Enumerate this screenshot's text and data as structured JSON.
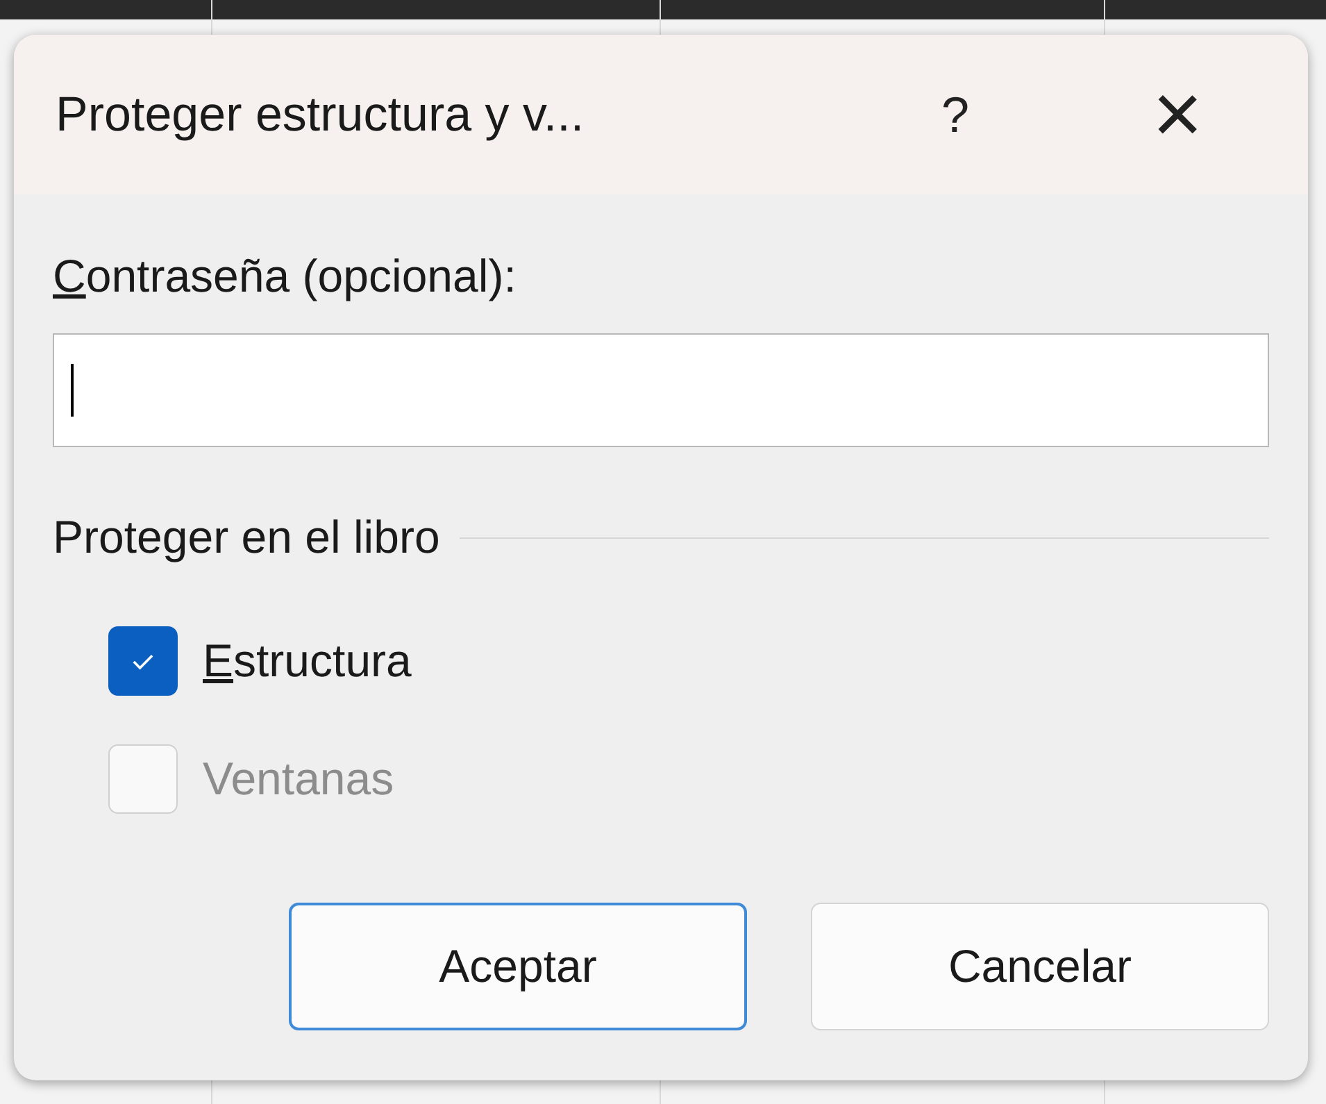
{
  "dialog": {
    "title": "Proteger estructura y v...",
    "help": "?",
    "close": "×"
  },
  "password": {
    "label": "Contraseña (opcional):",
    "mnemonic": true,
    "focused": true
  },
  "group": {
    "label": "Proteger en el libro",
    "options": [
      {
        "label": "Estructura",
        "checked": true,
        "disabled": false,
        "mnemonic": true
      },
      {
        "label": "Ventanas",
        "checked": false,
        "disabled": true,
        "mnemonic": false
      }
    ]
  },
  "buttons": [
    {
      "label": "Aceptar",
      "default": true
    },
    {
      "label": "Cancelar",
      "default": false
    }
  ]
}
